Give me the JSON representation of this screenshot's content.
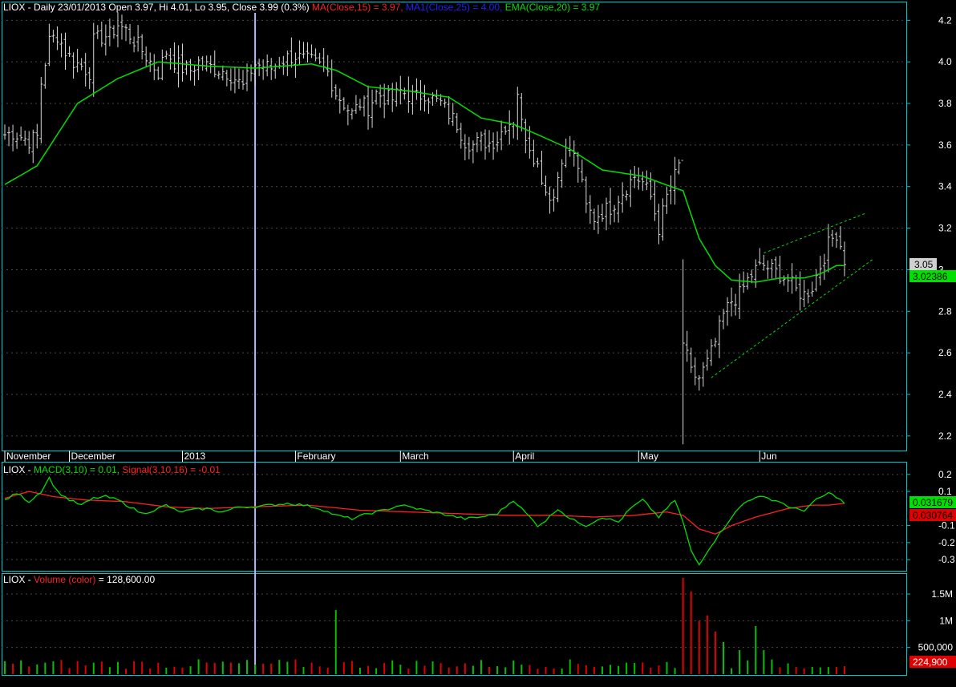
{
  "legend": {
    "price": {
      "prefix": "LIOX - Daily 23/01/2013 Open 3.97, Hi 4.01, Lo 3.95, Close 3.99 (0.3%)",
      "ma": "MA(Close,15) = 3.97,",
      "ma1": "MA1(Close,25) = 4.00,",
      "ema": "EMA(Close,20) = 3.97"
    },
    "macd": {
      "prefix": "LIOX -",
      "macd": "MACD(3,10) = 0.01,",
      "signal": "Signal(3,10,16) = -0.01"
    },
    "volume": {
      "prefix": "LIOX -",
      "vol": "Volume (color)",
      "value": "= 128,600.00"
    }
  },
  "colors": {
    "background": "#000000",
    "border": "#00c8c8",
    "grid": "#4a4a4a",
    "bars": "#d8d8d8",
    "ema": "#00e000",
    "ma": "#ff2020",
    "ma1": "#2020ff",
    "signal": "#ff2020",
    "volume_up": "#00c000",
    "volume_down": "#e00000",
    "cursor": "#b4b4ff",
    "trendline": "#00e000"
  },
  "chart_data": [
    {
      "type": "ohlc",
      "name": "price",
      "ylim": [
        2.13,
        4.29
      ],
      "yticks": [
        2.2,
        2.4,
        2.6,
        2.8,
        3.0,
        3.2,
        3.4,
        3.6,
        3.8,
        4.0,
        4.2
      ],
      "ytick_labels": [
        "2.2",
        "2.4",
        "2.6",
        "2.8",
        "3",
        "3.2",
        "3.4",
        "3.6",
        "3.8",
        "4.0",
        "4.2"
      ],
      "month_labels": [
        {
          "label": "November",
          "index": 0
        },
        {
          "label": "December",
          "index": 16
        },
        {
          "label": "2013",
          "index": 44
        },
        {
          "label": "February",
          "index": 72
        },
        {
          "label": "March",
          "index": 98
        },
        {
          "label": "April",
          "index": 126
        },
        {
          "label": "May",
          "index": 157
        },
        {
          "label": "Jun",
          "index": 187
        }
      ],
      "num_bars": 205,
      "cursor_index": 62,
      "last_price_label": "3.05",
      "ema_last_label": "3.02386",
      "anchors": [
        [
          0,
          3.65
        ],
        [
          2,
          3.66
        ],
        [
          4,
          3.64
        ],
        [
          6,
          3.62
        ],
        [
          8,
          3.64
        ],
        [
          9,
          3.9
        ],
        [
          11,
          4.1
        ],
        [
          13,
          4.13
        ],
        [
          15,
          4.05
        ],
        [
          17,
          4.0
        ],
        [
          19,
          3.98
        ],
        [
          21,
          3.95
        ],
        [
          22,
          4.1
        ],
        [
          24,
          4.12
        ],
        [
          26,
          4.13
        ],
        [
          28,
          4.18
        ],
        [
          30,
          4.15
        ],
        [
          33,
          4.08
        ],
        [
          36,
          4.0
        ],
        [
          38,
          3.95
        ],
        [
          40,
          4.05
        ],
        [
          42,
          4.0
        ],
        [
          44,
          3.97
        ],
        [
          46,
          3.96
        ],
        [
          48,
          4.0
        ],
        [
          50,
          3.98
        ],
        [
          52,
          3.97
        ],
        [
          55,
          3.95
        ],
        [
          57,
          3.92
        ],
        [
          59,
          3.88
        ],
        [
          61,
          3.96
        ],
        [
          62,
          3.99
        ],
        [
          64,
          3.98
        ],
        [
          66,
          3.97
        ],
        [
          68,
          4.0
        ],
        [
          70,
          4.02
        ],
        [
          72,
          4.03
        ],
        [
          74,
          4.01
        ],
        [
          76,
          4.0
        ],
        [
          78,
          3.98
        ],
        [
          80,
          3.95
        ],
        [
          82,
          3.85
        ],
        [
          84,
          3.8
        ],
        [
          86,
          3.75
        ],
        [
          88,
          3.8
        ],
        [
          90,
          3.78
        ],
        [
          92,
          3.85
        ],
        [
          94,
          3.83
        ],
        [
          96,
          3.82
        ],
        [
          98,
          3.86
        ],
        [
          100,
          3.84
        ],
        [
          102,
          3.83
        ],
        [
          104,
          3.85
        ],
        [
          106,
          3.82
        ],
        [
          108,
          3.8
        ],
        [
          110,
          3.75
        ],
        [
          112,
          3.7
        ],
        [
          114,
          3.62
        ],
        [
          116,
          3.6
        ],
        [
          118,
          3.62
        ],
        [
          120,
          3.61
        ],
        [
          122,
          3.63
        ],
        [
          124,
          3.7
        ],
        [
          126,
          3.72
        ],
        [
          127,
          3.86
        ],
        [
          128,
          3.7
        ],
        [
          129,
          3.65
        ],
        [
          131,
          3.55
        ],
        [
          133,
          3.45
        ],
        [
          134,
          3.38
        ],
        [
          136,
          3.35
        ],
        [
          138,
          3.55
        ],
        [
          140,
          3.58
        ],
        [
          142,
          3.5
        ],
        [
          144,
          3.3
        ],
        [
          146,
          3.25
        ],
        [
          148,
          3.28
        ],
        [
          150,
          3.3
        ],
        [
          152,
          3.35
        ],
        [
          154,
          3.4
        ],
        [
          156,
          3.45
        ],
        [
          158,
          3.42
        ],
        [
          160,
          3.35
        ],
        [
          162,
          3.2
        ],
        [
          164,
          3.35
        ],
        [
          166,
          3.45
        ],
        [
          167,
          3.5
        ],
        [
          168,
          2.65
        ],
        [
          170,
          2.5
        ],
        [
          172,
          2.48
        ],
        [
          174,
          2.55
        ],
        [
          176,
          2.65
        ],
        [
          178,
          2.78
        ],
        [
          180,
          2.85
        ],
        [
          182,
          2.88
        ],
        [
          184,
          2.95
        ],
        [
          186,
          3.0
        ],
        [
          188,
          3.02
        ],
        [
          190,
          3.0
        ],
        [
          192,
          2.98
        ],
        [
          194,
          2.95
        ],
        [
          196,
          2.9
        ],
        [
          198,
          2.88
        ],
        [
          200,
          2.92
        ],
        [
          202,
          3.02
        ],
        [
          204,
          3.12
        ],
        [
          206,
          3.18
        ],
        [
          207,
          3.12
        ],
        [
          208,
          3.05
        ]
      ],
      "ema_anchors": [
        [
          0,
          3.41
        ],
        [
          8,
          3.5
        ],
        [
          18,
          3.8
        ],
        [
          28,
          3.92
        ],
        [
          38,
          4.0
        ],
        [
          50,
          3.98
        ],
        [
          62,
          3.97
        ],
        [
          76,
          3.99
        ],
        [
          82,
          3.96
        ],
        [
          90,
          3.88
        ],
        [
          100,
          3.86
        ],
        [
          110,
          3.83
        ],
        [
          118,
          3.73
        ],
        [
          126,
          3.7
        ],
        [
          132,
          3.65
        ],
        [
          140,
          3.58
        ],
        [
          148,
          3.48
        ],
        [
          158,
          3.45
        ],
        [
          165,
          3.4
        ],
        [
          168,
          3.38
        ],
        [
          172,
          3.15
        ],
        [
          176,
          3.02
        ],
        [
          180,
          2.95
        ],
        [
          186,
          2.94
        ],
        [
          192,
          2.96
        ],
        [
          198,
          2.96
        ],
        [
          202,
          2.98
        ],
        [
          206,
          3.02
        ],
        [
          208,
          3.02
        ]
      ],
      "trend_lower": [
        [
          175,
          2.48
        ],
        [
          215,
          3.05
        ]
      ],
      "trend_upper": [
        [
          188,
          3.08
        ],
        [
          213,
          3.27
        ]
      ]
    },
    {
      "type": "line",
      "name": "macd",
      "ylim": [
        -0.37,
        0.265
      ],
      "yticks": [
        0.2,
        0.1,
        -0.1,
        -0.2,
        -0.3
      ],
      "ytick_labels": [
        "0.2",
        "0.1",
        "-0.1",
        "-0.2",
        "-0.3"
      ],
      "macd_last_label": "0.031679",
      "signal_last_label": "0.030764",
      "macd_anchors": [
        [
          0,
          0.05
        ],
        [
          3,
          0.09
        ],
        [
          6,
          0.04
        ],
        [
          9,
          0.1
        ],
        [
          11,
          0.18
        ],
        [
          13,
          0.1
        ],
        [
          16,
          0.05
        ],
        [
          19,
          0.02
        ],
        [
          22,
          0.06
        ],
        [
          25,
          0.07
        ],
        [
          28,
          0.05
        ],
        [
          31,
          0.01
        ],
        [
          34,
          -0.03
        ],
        [
          37,
          -0.01
        ],
        [
          40,
          0.02
        ],
        [
          43,
          -0.02
        ],
        [
          46,
          -0.01
        ],
        [
          50,
          0.0
        ],
        [
          54,
          -0.02
        ],
        [
          58,
          0.01
        ],
        [
          62,
          0.01
        ],
        [
          66,
          0.02
        ],
        [
          70,
          0.03
        ],
        [
          74,
          0.02
        ],
        [
          78,
          0.0
        ],
        [
          82,
          -0.04
        ],
        [
          86,
          -0.06
        ],
        [
          90,
          -0.03
        ],
        [
          94,
          -0.01
        ],
        [
          98,
          0.02
        ],
        [
          102,
          0.0
        ],
        [
          106,
          -0.02
        ],
        [
          110,
          -0.04
        ],
        [
          114,
          -0.06
        ],
        [
          118,
          -0.05
        ],
        [
          122,
          -0.03
        ],
        [
          126,
          0.05
        ],
        [
          128,
          0.0
        ],
        [
          130,
          -0.05
        ],
        [
          132,
          -0.1
        ],
        [
          134,
          -0.07
        ],
        [
          137,
          0.0
        ],
        [
          140,
          -0.06
        ],
        [
          144,
          -0.1
        ],
        [
          148,
          -0.05
        ],
        [
          152,
          -0.08
        ],
        [
          155,
          0.0
        ],
        [
          158,
          0.05
        ],
        [
          160,
          0.0
        ],
        [
          162,
          -0.05
        ],
        [
          164,
          0.0
        ],
        [
          166,
          0.05
        ],
        [
          168,
          -0.08
        ],
        [
          170,
          -0.25
        ],
        [
          172,
          -0.33
        ],
        [
          174,
          -0.25
        ],
        [
          177,
          -0.15
        ],
        [
          180,
          -0.05
        ],
        [
          183,
          0.03
        ],
        [
          186,
          0.07
        ],
        [
          189,
          0.06
        ],
        [
          192,
          0.04
        ],
        [
          195,
          0.0
        ],
        [
          198,
          -0.01
        ],
        [
          201,
          0.05
        ],
        [
          204,
          0.09
        ],
        [
          206,
          0.07
        ],
        [
          208,
          0.03
        ]
      ],
      "signal_anchors": [
        [
          0,
          0.06
        ],
        [
          6,
          0.1
        ],
        [
          12,
          0.07
        ],
        [
          20,
          0.05
        ],
        [
          30,
          0.04
        ],
        [
          40,
          0.01
        ],
        [
          50,
          0.0
        ],
        [
          62,
          0.01
        ],
        [
          75,
          0.02
        ],
        [
          88,
          -0.01
        ],
        [
          100,
          -0.02
        ],
        [
          112,
          -0.03
        ],
        [
          124,
          -0.04
        ],
        [
          136,
          -0.04
        ],
        [
          146,
          -0.05
        ],
        [
          156,
          -0.04
        ],
        [
          164,
          -0.02
        ],
        [
          168,
          -0.04
        ],
        [
          172,
          -0.12
        ],
        [
          176,
          -0.15
        ],
        [
          180,
          -0.1
        ],
        [
          186,
          -0.05
        ],
        [
          194,
          0.0
        ],
        [
          200,
          0.02
        ],
        [
          204,
          0.02
        ],
        [
          208,
          0.03
        ]
      ]
    },
    {
      "type": "bar",
      "name": "volume",
      "ylim": [
        0,
        1890000
      ],
      "yticks": [
        1500000,
        1000000,
        500000
      ],
      "ytick_labels": [
        "1.5M",
        "1M",
        "500,000"
      ],
      "last_label": "224,900",
      "base_volume": 200000,
      "spikes": [
        [
          62,
          180000,
          "up"
        ],
        [
          82,
          1200000,
          "up"
        ],
        [
          168,
          1800000,
          "down"
        ],
        [
          169,
          1150000,
          "down"
        ],
        [
          170,
          1550000,
          "down"
        ],
        [
          171,
          1600000,
          "down"
        ],
        [
          172,
          1000000,
          "down"
        ],
        [
          173,
          1650000,
          "down"
        ],
        [
          174,
          1100000,
          "down"
        ],
        [
          176,
          800000,
          "down"
        ],
        [
          177,
          550000,
          "up"
        ],
        [
          178,
          600000,
          "up"
        ],
        [
          182,
          450000,
          "up"
        ],
        [
          186,
          900000,
          "up"
        ],
        [
          189,
          450000,
          "up"
        ]
      ]
    }
  ]
}
